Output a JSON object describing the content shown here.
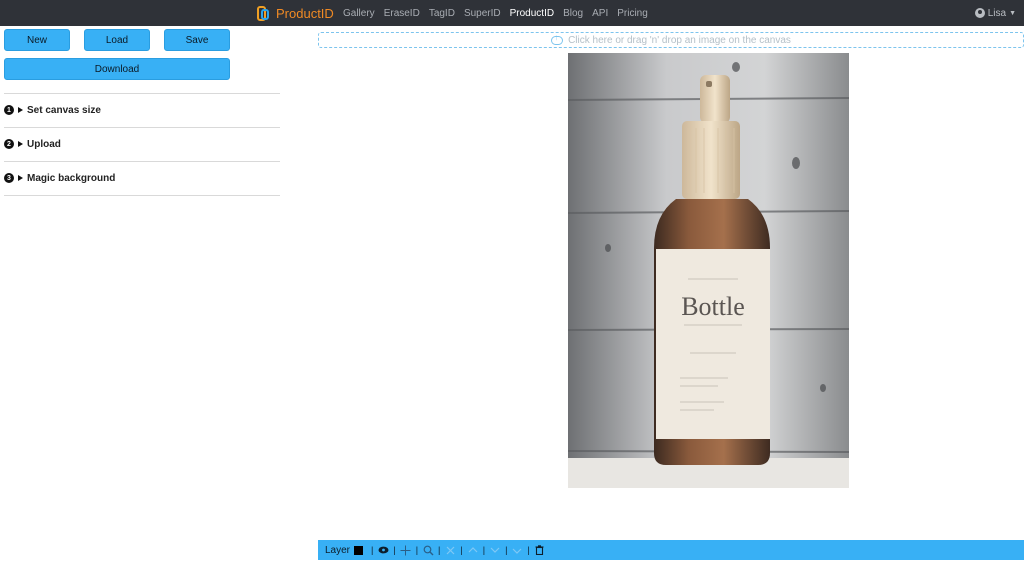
{
  "navbar": {
    "brand": "ProductID",
    "links": [
      "Gallery",
      "EraseID",
      "TagID",
      "SuperID",
      "ProductID",
      "Blog",
      "API",
      "Pricing"
    ],
    "active_link": "ProductID",
    "user": "Lisa"
  },
  "sidebar": {
    "buttons": {
      "new": "New",
      "load": "Load",
      "save": "Save",
      "download": "Download"
    },
    "steps": [
      {
        "num": "1",
        "label": "Set canvas size"
      },
      {
        "num": "2",
        "label": "Upload"
      },
      {
        "num": "3",
        "label": "Magic background"
      }
    ]
  },
  "dropzone": {
    "text": "Click here or drag 'n' drop an image on the canvas"
  },
  "canvas_image": {
    "label_big": "Bottle",
    "icon": "bottle-photo"
  },
  "layerbar": {
    "label": "Layer",
    "tools": [
      "eye-icon",
      "move-icon",
      "zoom-icon",
      "close-icon",
      "bring-up-icon",
      "send-down-icon",
      "merge-down-icon",
      "trash-icon"
    ]
  },
  "colors": {
    "navbar": "#2f3238",
    "accent": "#38b0f5",
    "brand_orange": "#f08a24",
    "brand_blue": "#2aa6ee"
  }
}
